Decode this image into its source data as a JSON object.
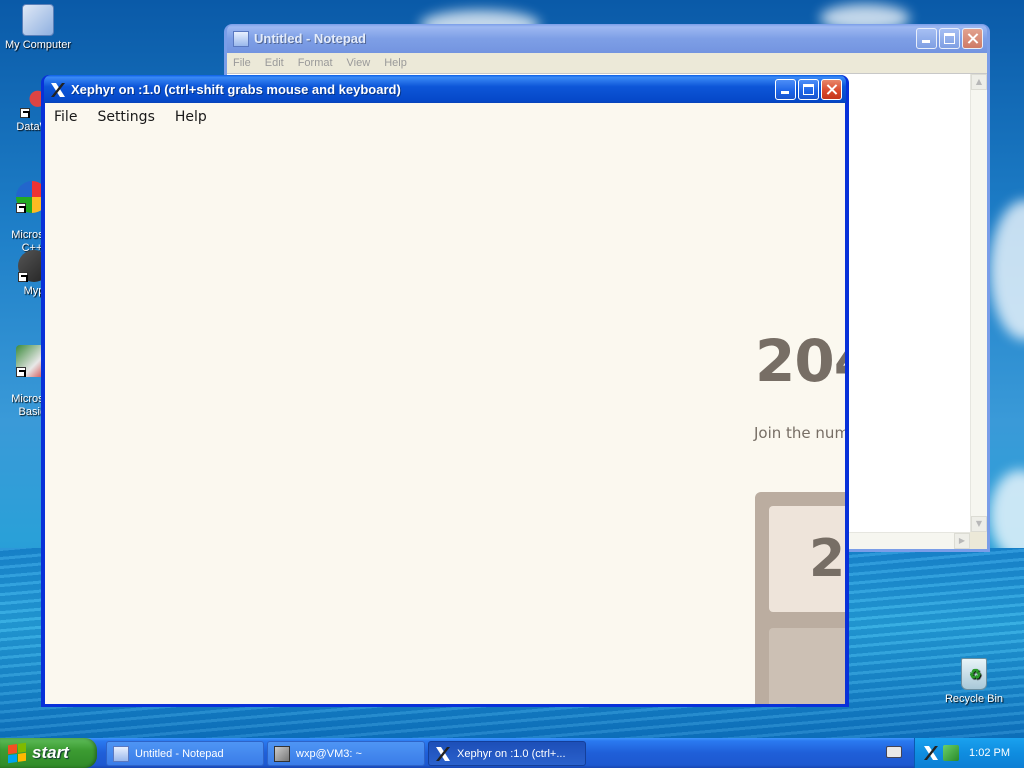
{
  "desktop": {
    "icons": [
      {
        "label": "My Computer"
      },
      {
        "label": "DataWa"
      },
      {
        "label": "Microsof\nC++"
      },
      {
        "label": "Myp"
      },
      {
        "label": "Microsof\nBasic"
      },
      {
        "label": "Recycle Bin"
      }
    ]
  },
  "notepad": {
    "title": "Untitled - Notepad",
    "menu": [
      "File",
      "Edit",
      "Format",
      "View",
      "Help"
    ]
  },
  "xephyr": {
    "title": "Xephyr on :1.0 (ctrl+shift grabs mouse and keyboard)",
    "menu": [
      "File",
      "Settings",
      "Help"
    ],
    "game": {
      "title": "204",
      "intro": "Join the num",
      "tile_value": "2"
    }
  },
  "taskbar": {
    "start_label": "start",
    "tasks": [
      {
        "label": "Untitled - Notepad"
      },
      {
        "label": "wxp@VM3: ~"
      },
      {
        "label": "Xephyr on :1.0 (ctrl+..."
      }
    ],
    "clock": "1:02 PM"
  },
  "colors": {
    "xp_blue": "#0831d9",
    "start_green": "#3c9c32",
    "game_text": "#776e65",
    "game_bg": "#fbf8ef",
    "grid_bg": "#bbada0"
  }
}
